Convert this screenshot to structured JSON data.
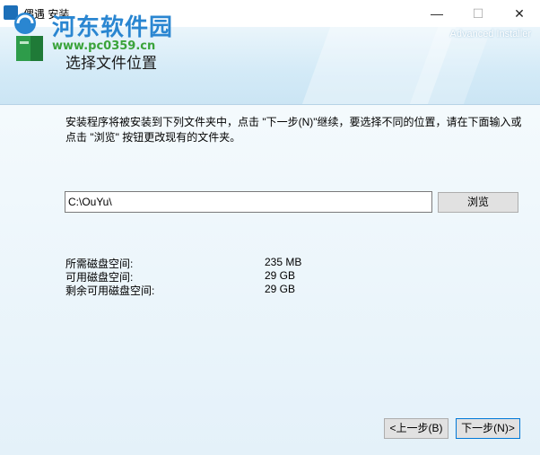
{
  "window": {
    "title": "偶遇 安装",
    "minimize_glyph": "—",
    "maximize_glyph": "☐",
    "close_glyph": "✕"
  },
  "header": {
    "title": "选择文件位置",
    "brand": "Advanced Installer",
    "watermark_main": "河东软件园",
    "watermark_url": "www.pc0359.cn"
  },
  "content": {
    "description": "安装程序将被安装到下列文件夹中，点击 \"下一步(N)\"继续，要选择不同的位置，请在下面输入或点击 \"浏览\" 按钮更改现有的文件夹。",
    "install_path": "C:\\OuYu\\",
    "browse_label": "浏览",
    "space": [
      {
        "label": "所需磁盘空间:",
        "value": "235 MB"
      },
      {
        "label": "可用磁盘空间:",
        "value": "29 GB"
      },
      {
        "label": "剩余可用磁盘空间:",
        "value": "29 GB"
      }
    ]
  },
  "footer": {
    "back_label": "<上一步(B)",
    "next_label": "下一步(N)>"
  },
  "colors": {
    "accent": "#0078d7",
    "header_band": "#d3eaf7",
    "watermark_blue": "#2a86d1",
    "watermark_green": "#3aa33a"
  }
}
